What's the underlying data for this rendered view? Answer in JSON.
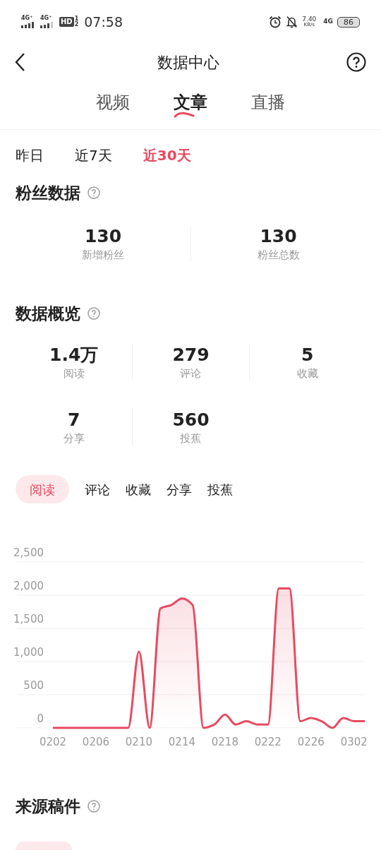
{
  "status_bar": {
    "sim1": "4G⁺",
    "sim2": "4G⁺",
    "hd": "HD",
    "hd_slots": [
      "1",
      "2"
    ],
    "time": "07:58",
    "speed": "7.40",
    "speed_unit": "KB/s",
    "network": "4G",
    "battery": "86"
  },
  "header": {
    "title": "数据中心"
  },
  "tabs": [
    {
      "label": "视频",
      "selected": false
    },
    {
      "label": "文章",
      "selected": true
    },
    {
      "label": "直播",
      "selected": false
    }
  ],
  "periods": [
    {
      "label": "昨日",
      "selected": false
    },
    {
      "label": "近7天",
      "selected": false
    },
    {
      "label": "近30天",
      "selected": true
    }
  ],
  "fans": {
    "title": "粉丝数据",
    "stats": [
      {
        "value": "130",
        "label": "新增粉丝"
      },
      {
        "value": "130",
        "label": "粉丝总数"
      }
    ]
  },
  "overview": {
    "title": "数据概览",
    "stats": [
      {
        "value": "1.4万",
        "label": "阅读"
      },
      {
        "value": "279",
        "label": "评论"
      },
      {
        "value": "5",
        "label": "收藏"
      },
      {
        "value": "7",
        "label": "分享"
      },
      {
        "value": "560",
        "label": "投蕉"
      }
    ],
    "metrics": [
      {
        "label": "阅读",
        "selected": true
      },
      {
        "label": "评论",
        "selected": false
      },
      {
        "label": "收藏",
        "selected": false
      },
      {
        "label": "分享",
        "selected": false
      },
      {
        "label": "投蕉",
        "selected": false
      }
    ],
    "chart_data": {
      "type": "area",
      "grid": true,
      "categories": [
        "0202",
        null,
        null,
        null,
        "0206",
        null,
        null,
        null,
        "0210",
        null,
        null,
        null,
        "0214",
        null,
        null,
        null,
        "0218",
        null,
        null,
        null,
        "0222",
        null,
        null,
        null,
        "0226",
        null,
        null,
        null,
        "0302",
        null
      ],
      "series": [
        {
          "color": "#e84a5f",
          "values": [
            0,
            0,
            0,
            0,
            0,
            0,
            0,
            0,
            1150,
            0,
            1800,
            1850,
            1950,
            1850,
            0,
            50,
            200,
            50,
            100,
            50,
            50,
            2100,
            2100,
            100,
            150,
            100,
            0,
            150,
            100,
            100
          ]
        }
      ],
      "ylim": [
        0,
        2500
      ],
      "yticks": [
        {
          "value": 0,
          "label": "0"
        },
        {
          "value": 500,
          "label": "500"
        },
        {
          "value": 1000,
          "label": "1,000"
        },
        {
          "value": 1500,
          "label": "1,500"
        },
        {
          "value": 2000,
          "label": "2,000"
        },
        {
          "value": 2500,
          "label": "2,500"
        }
      ]
    }
  },
  "sources": {
    "title": "来源稿件"
  }
}
